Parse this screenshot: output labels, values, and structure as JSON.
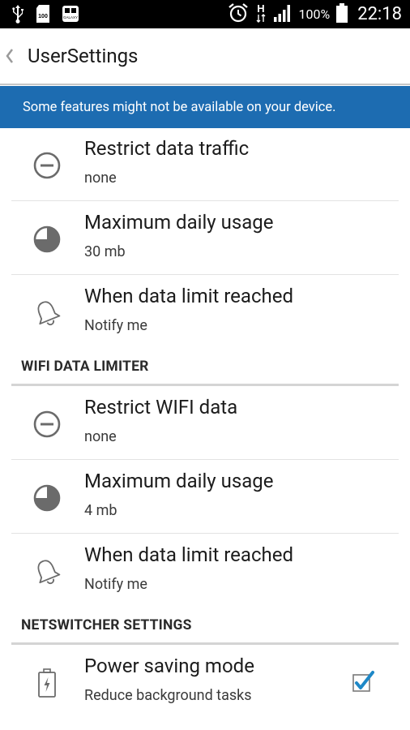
{
  "status_bar": {
    "battery_text": "100%",
    "time": "22:18",
    "network_type": "H",
    "icons": [
      "usb-icon",
      "sd-card-100-icon",
      "galaxy-card-icon",
      "alarm-icon",
      "network-h-icon",
      "signal-icon",
      "battery-icon"
    ]
  },
  "action_bar": {
    "title": "UserSettings"
  },
  "banner": {
    "text": "Some features might not be available on your device."
  },
  "mobile_rows": [
    {
      "title": "Restrict data traffic",
      "summary": "none",
      "icon": "minus-circle-icon"
    },
    {
      "title": "Maximum daily usage",
      "summary": "30 mb",
      "icon": "pie-chart-icon"
    },
    {
      "title": "When data limit reached",
      "summary": "Notify me",
      "icon": "bell-icon"
    }
  ],
  "wifi_section": {
    "header": "WIFI DATA LIMITER",
    "rows": [
      {
        "title": "Restrict WIFI data",
        "summary": "none",
        "icon": "minus-circle-icon"
      },
      {
        "title": "Maximum daily usage",
        "summary": "4 mb",
        "icon": "pie-chart-icon"
      },
      {
        "title": "When data limit reached",
        "summary": "Notify me",
        "icon": "bell-icon"
      }
    ]
  },
  "netswitcher_section": {
    "header": "NETSWITCHER SETTINGS",
    "rows": [
      {
        "title": "Power saving mode",
        "summary": "Reduce background tasks",
        "icon": "battery-charging-icon",
        "checked": true
      }
    ]
  },
  "colors": {
    "banner_bg": "#1d6cb1",
    "checkbox_check": "#1e88c7",
    "icon_gray": "#6b6b6b"
  }
}
